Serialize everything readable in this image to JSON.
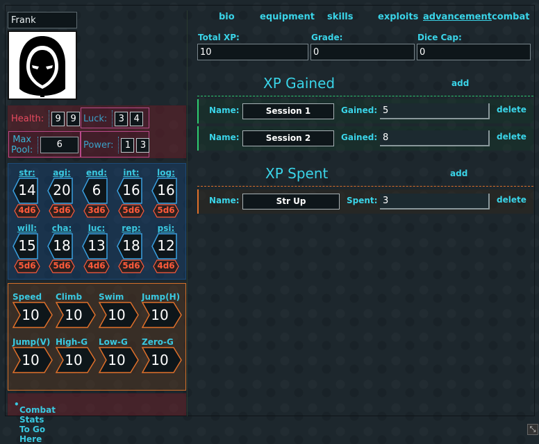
{
  "character": {
    "name": "Frank"
  },
  "portrait": {
    "icon": "hooded-figure-icon"
  },
  "vitals": {
    "health_label": "Health:",
    "health_values": [
      "9",
      "9"
    ],
    "luck_label": "Luck:",
    "luck_values": [
      "3",
      "4"
    ],
    "max_pool_label_1": "Max",
    "max_pool_label_2": "Pool:",
    "max_pool_value": "6",
    "power_label": "Power:",
    "power_values": [
      "1",
      "3"
    ]
  },
  "attributes": [
    {
      "label": "str:",
      "value": "14",
      "dice": "4d6"
    },
    {
      "label": "agi:",
      "value": "20",
      "dice": "5d6"
    },
    {
      "label": "end:",
      "value": "6",
      "dice": "3d6"
    },
    {
      "label": "int:",
      "value": "16",
      "dice": "5d6"
    },
    {
      "label": "log:",
      "value": "16",
      "dice": "5d6"
    },
    {
      "label": "will:",
      "value": "15",
      "dice": "5d6"
    },
    {
      "label": "cha:",
      "value": "18",
      "dice": "5d6"
    },
    {
      "label": "luc:",
      "value": "13",
      "dice": "4d6"
    },
    {
      "label": "rep:",
      "value": "18",
      "dice": "5d6"
    },
    {
      "label": "psi:",
      "value": "12",
      "dice": "4d6"
    }
  ],
  "movement": [
    {
      "label": "Speed",
      "value": "10"
    },
    {
      "label": "Climb",
      "value": "10"
    },
    {
      "label": "Swim",
      "value": "10"
    },
    {
      "label": "Jump(H)",
      "value": "10"
    },
    {
      "label": "Jump(V)",
      "value": "10"
    },
    {
      "label": "High-G",
      "value": "10"
    },
    {
      "label": "Low-G",
      "value": "10"
    },
    {
      "label": "Zero-G",
      "value": "10"
    }
  ],
  "combat": {
    "placeholder": "Combat Stats To Go Here"
  },
  "tabs": [
    {
      "label": "bio"
    },
    {
      "label": "equipment"
    },
    {
      "label": "skills"
    },
    {
      "label": "exploits"
    },
    {
      "label": "advancement"
    },
    {
      "label": "combat"
    }
  ],
  "active_tab": "advancement",
  "summary": {
    "total_xp_label": "Total XP:",
    "total_xp": "10",
    "grade_label": "Grade:",
    "grade": "0",
    "dice_cap_label": "Dice Cap:",
    "dice_cap": "0"
  },
  "xp_gained": {
    "title": "XP Gained",
    "add_label": "add",
    "name_label": "Name:",
    "value_label": "Gained:",
    "delete_label": "delete",
    "entries": [
      {
        "name": "Session 1",
        "value": "5"
      },
      {
        "name": "Session 2",
        "value": "8"
      }
    ]
  },
  "xp_spent": {
    "title": "XP Spent",
    "add_label": "add",
    "name_label": "Name:",
    "value_label": "Spent:",
    "delete_label": "delete",
    "entries": [
      {
        "name": "Str Up",
        "value": "3"
      }
    ]
  },
  "colors": {
    "accent": "#3ad4e8",
    "health": "#e84a5f",
    "dice": "#ff5a3a",
    "gained_border": "#2ecc71",
    "spent_border": "#e0702a"
  }
}
